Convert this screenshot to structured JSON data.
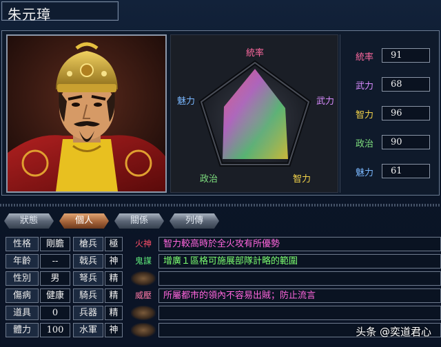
{
  "officer": {
    "name": "朱元璋"
  },
  "radar": {
    "labels": {
      "command": "統率",
      "war": "武力",
      "intelligence": "智力",
      "politics": "政治",
      "charisma": "魅力"
    }
  },
  "stats": [
    {
      "label": "統率",
      "value": "91",
      "color": "#ff6aa0"
    },
    {
      "label": "武力",
      "value": "68",
      "color": "#d98cff"
    },
    {
      "label": "智力",
      "value": "96",
      "color": "#f4d44a"
    },
    {
      "label": "政治",
      "value": "90",
      "color": "#7fe07f"
    },
    {
      "label": "魅力",
      "value": "61",
      "color": "#7ab8ff"
    }
  ],
  "tabs": [
    "狀態",
    "個人",
    "關係",
    "列傳"
  ],
  "active_tab": "個人",
  "attributes": [
    {
      "label": "性格",
      "value": "剛膽"
    },
    {
      "label": "年齡",
      "value": "--"
    },
    {
      "label": "性別",
      "value": "男"
    },
    {
      "label": "傷病",
      "value": "健康"
    },
    {
      "label": "道具",
      "value": "0"
    },
    {
      "label": "體力",
      "value": "100"
    }
  ],
  "troops": [
    {
      "label": "槍兵",
      "value": "極"
    },
    {
      "label": "戟兵",
      "value": "神"
    },
    {
      "label": "弩兵",
      "value": "精"
    },
    {
      "label": "騎兵",
      "value": "精"
    },
    {
      "label": "兵器",
      "value": "精"
    },
    {
      "label": "水軍",
      "value": "神"
    }
  ],
  "skills": [
    {
      "name": "火神",
      "name_color": "#ff4f6a",
      "desc": "智力較高時於全火攻有所優勢",
      "desc_color": "#ff66dd"
    },
    {
      "name": "鬼謀",
      "name_color": "#5ee87a",
      "desc": "增廣１區格可施展部隊計略的範圍",
      "desc_color": "#7cff70"
    },
    {
      "name": "",
      "name_color": "",
      "desc": "",
      "desc_color": ""
    },
    {
      "name": "威壓",
      "name_color": "#ff7aa8",
      "desc": "所屬都市的領內不容易出賊；防止流言",
      "desc_color": "#ff66dd"
    },
    {
      "name": "",
      "name_color": "",
      "desc": "",
      "desc_color": ""
    },
    {
      "name": "",
      "name_color": "",
      "desc": "",
      "desc_color": ""
    }
  ],
  "watermark": "头条 @奕道君心"
}
